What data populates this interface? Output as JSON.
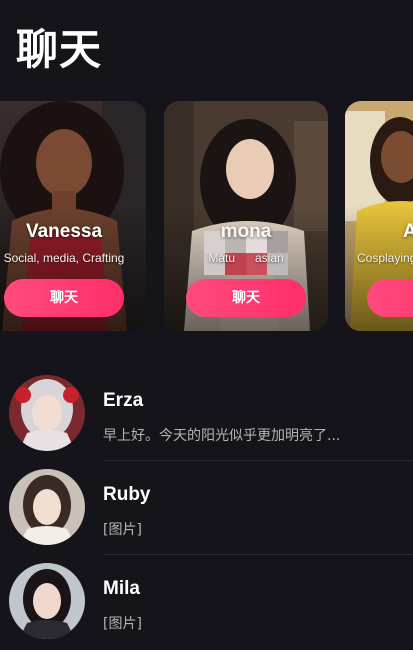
{
  "header": {
    "title": "聊天"
  },
  "cards": [
    {
      "name": "Vanessa",
      "tags": "Social, media, Crafting",
      "button": "聊天"
    },
    {
      "name": "mona",
      "tags": "Matu      asian",
      "button": "聊天"
    },
    {
      "name": "A",
      "tags": "Cosplaying",
      "button": "聊天"
    }
  ],
  "chats": [
    {
      "name": "Erza",
      "message": "早上好。今天的阳光似乎更加明亮了..."
    },
    {
      "name": "Ruby",
      "message": "[图片]"
    },
    {
      "name": "Mila",
      "message": "[图片]"
    }
  ],
  "colors": {
    "background": "#15141a",
    "accent": "#ff3d74"
  }
}
